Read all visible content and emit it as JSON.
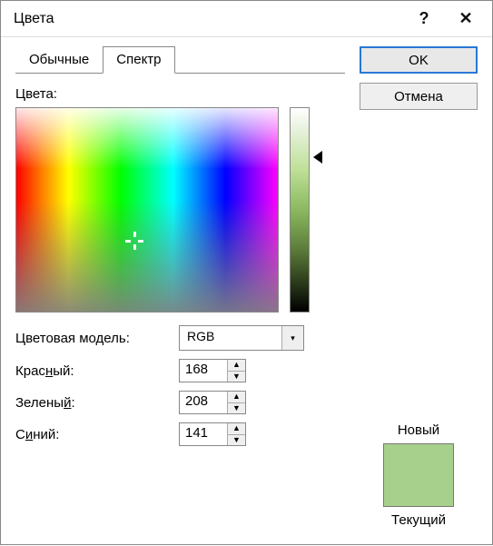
{
  "window": {
    "title": "Цвета",
    "help": "?",
    "close": "✕"
  },
  "buttons": {
    "ok": "OK",
    "cancel": "Отмена"
  },
  "tabs": {
    "standard": "Обычные",
    "spectrum": "Спектр"
  },
  "labels": {
    "colors": "Цвета:",
    "model": "Цветовая модель:",
    "red_pre": "Крас",
    "red_u": "н",
    "red_post": "ый:",
    "green_pre": "Зелены",
    "green_u": "й",
    "green_post": ":",
    "blue_pre": "С",
    "blue_u": "и",
    "blue_post": "ний:",
    "new": "Новый",
    "current": "Текущий"
  },
  "values": {
    "model": "RGB",
    "red": "168",
    "green": "208",
    "blue": "141",
    "swatch_hex": "#a8d08d"
  }
}
